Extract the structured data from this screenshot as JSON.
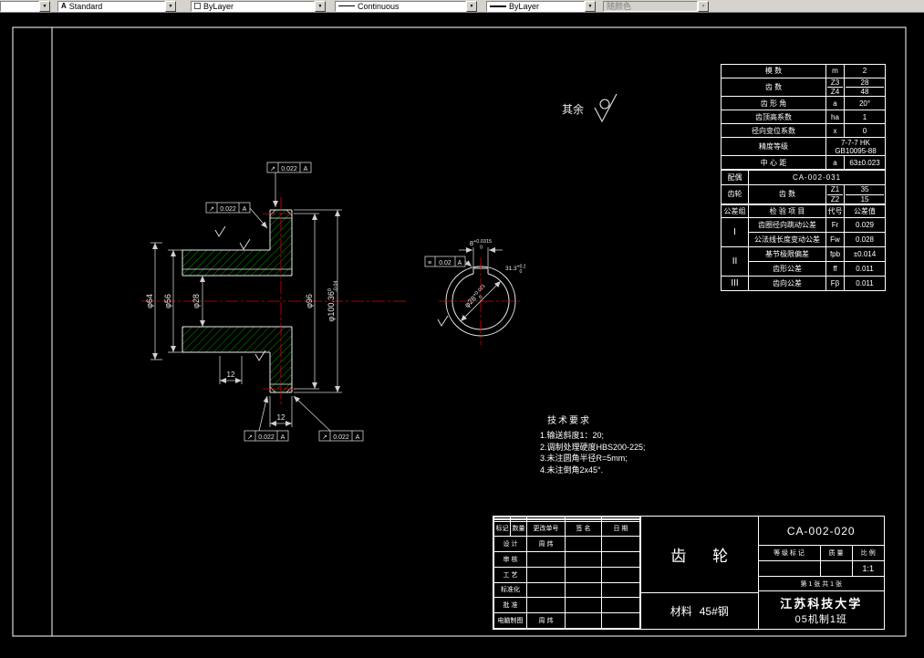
{
  "toolbar": {
    "style_value": "Standard",
    "color_value": "ByLayer",
    "linetype_value": "Continuous",
    "lineweight_value": "ByLayer",
    "plotstyle_value": "随颜色"
  },
  "notes": {
    "other_surfaces": "其余",
    "tech_title": "技术要求",
    "tech_items": [
      "1.输送斜度1：20;",
      "2.调制处理硬度HBS200-225;",
      "3.未注圆角半径R=5mm;",
      "4.未注倒角2x45°."
    ]
  },
  "dims": {
    "left_outer": "φ64",
    "hub_od": "φ56",
    "bore": "φ28",
    "root": "φ96",
    "tip": "φ100.36",
    "tip_sup": "0",
    "tip_sub": "-0.04",
    "hub_step_width": "12",
    "rim_width": "12"
  },
  "tol_frames": {
    "runout_symbol": "↗",
    "runout_value": "0.022",
    "datum": "A",
    "symmetry_symbol": "≡",
    "symmetry_value": "0.02"
  },
  "detail": {
    "keyway_width": "8",
    "keyway_width_sup": "+0.0315",
    "keyway_width_sub": "0",
    "keyway_depth": "31.3",
    "keyway_depth_sup": "+0.2",
    "keyway_depth_sub": "0",
    "bore": "φ28",
    "bore_sup": "+0.021",
    "bore_sub": "0"
  },
  "param_table": {
    "modulus_label": "模 数",
    "modulus_sym": "m",
    "modulus_val": "2",
    "teeth_label": "齿 数",
    "teeth_sym_1": "Z3",
    "teeth_sym_2": "Z4",
    "teeth_val_1": "28",
    "teeth_val_2": "48",
    "angle_label": "齿 形 角",
    "angle_sym": "a",
    "angle_val": "20°",
    "addendum_label": "齿顶高系数",
    "addendum_sym": "ha",
    "addendum_val": "1",
    "shift_label": "径向变位系数",
    "shift_sym": "x",
    "shift_val": "0",
    "accuracy_label": "精度等级",
    "accuracy_val_1": "7-7-7 HK",
    "accuracy_val_2": "GB10095-88",
    "center_label": "中 心 距",
    "center_sym": "a",
    "center_val": "63±0.023",
    "mate_label_1": "配偶",
    "mate_label_2": "齿轮",
    "mate_no": "CA-002-031",
    "mate_teeth_label": "齿 数",
    "mate_sym_1": "Z1",
    "mate_sym_2": "Z2",
    "mate_val_1": "35",
    "mate_val_2": "15",
    "group_label": "公差组",
    "item_label": "检 验 项 目",
    "code_label": "代号",
    "value_label": "公差值",
    "group_1": "I",
    "g1r1_item": "齿圈径向跳动公差",
    "g1r1_code": "Fr",
    "g1r1_val": "0.029",
    "g1r2_item": "公法线长度变动公差",
    "g1r2_code": "Fw",
    "g1r2_val": "0.028",
    "group_2": "II",
    "g2r1_item": "基节极限偏差",
    "g2r1_code": "fpb",
    "g2r1_val": "±0.014",
    "g2r2_item": "齿形公差",
    "g2r2_code": "ff",
    "g2r2_val": "0.011",
    "group_3": "III",
    "g3r1_item": "齿向公差",
    "g3r1_code": "Fβ",
    "g3r1_val": "0.011"
  },
  "title_block": {
    "part_name": "齿 轮",
    "drawing_no": "CA-002-020",
    "material_label": "材料",
    "material_value": "45#钢",
    "school": "江苏科技大学",
    "class_name": "05机制1班",
    "grade_label": "等 级 标 记",
    "weight_label": "质 量",
    "scale_label": "比 例",
    "scale_value": "1:1",
    "sheet_info": "第 1 张  共 1 张",
    "rev_mark": "标记",
    "rev_count": "数量",
    "rev_order": "更改单号",
    "rev_sign": "签 名",
    "rev_date": "日 期",
    "design_label": "设 计",
    "design_name": "周 炜",
    "check_label": "审 核",
    "process_label": "工 艺",
    "standard_label": "标准化",
    "approve_label": "批 准",
    "cad_label": "电脑制图",
    "cad_name": "周 炜"
  }
}
